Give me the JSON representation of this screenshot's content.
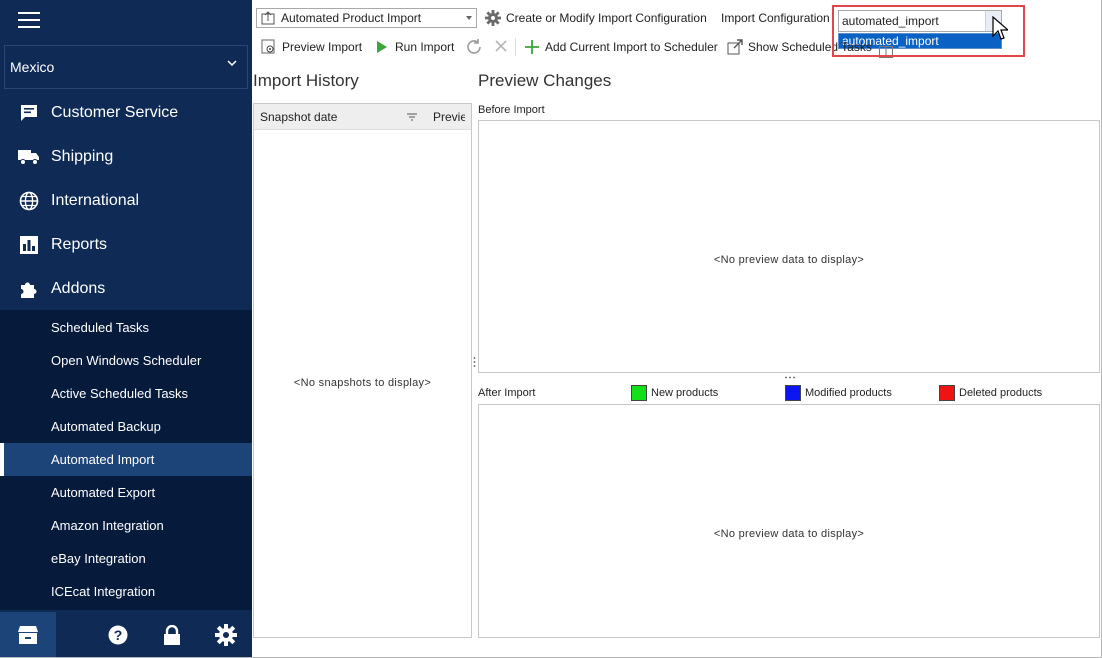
{
  "sidebar": {
    "store": "Mexico",
    "nav": [
      {
        "label": "Customer Service",
        "icon": "chat-icon"
      },
      {
        "label": "Shipping",
        "icon": "truck-icon"
      },
      {
        "label": "International",
        "icon": "globe-icon"
      },
      {
        "label": "Reports",
        "icon": "chart-icon"
      },
      {
        "label": "Addons",
        "icon": "puzzle-icon"
      }
    ],
    "sub_items": [
      "Scheduled Tasks",
      "Open Windows Scheduler",
      "Active Scheduled Tasks",
      "Automated Backup",
      "Automated Import",
      "Automated Export",
      "Amazon Integration",
      "eBay Integration",
      "ICEcat Integration"
    ],
    "active_sub_item": "Automated Import"
  },
  "toolbar": {
    "import_type": "Automated Product Import",
    "configure_label": "Create or Modify Import Configuration",
    "config_label": "Import Configuration",
    "config_value": "automated_import",
    "config_option": "automated_import",
    "preview_label": "Preview Import",
    "run_label": "Run Import",
    "add_scheduler_label": "Add Current Import to Scheduler",
    "show_scheduled_label": "Show Scheduled Tasks"
  },
  "history": {
    "title": "Import History",
    "col_snapshot": "Snapshot date",
    "col_preview": "Preview",
    "empty": "<No snapshots to display>"
  },
  "preview": {
    "title": "Preview Changes",
    "before_label": "Before Import",
    "after_label": "After Import",
    "empty": "<No preview data to display>",
    "legend": [
      {
        "label": "New products",
        "color": "#11e01b"
      },
      {
        "label": "Modified products",
        "color": "#0b16f2"
      },
      {
        "label": "Deleted products",
        "color": "#ef1414"
      }
    ]
  }
}
